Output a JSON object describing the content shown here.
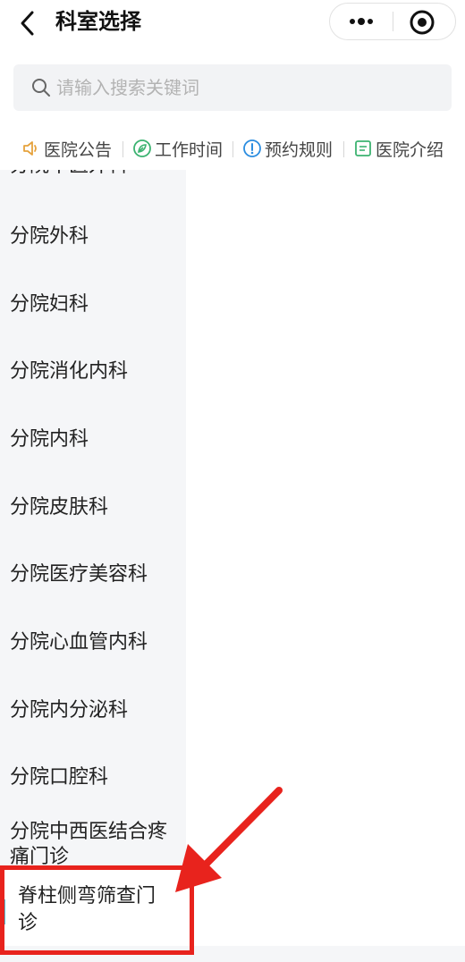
{
  "nav": {
    "title": "科室选择",
    "back_icon": "chevron-left-icon",
    "more_icon": "more-dots-icon",
    "close_icon": "target-circle-icon"
  },
  "search": {
    "placeholder": "请输入搜索关键词",
    "icon": "search-icon"
  },
  "tabs": [
    {
      "label": "医院公告",
      "icon": "speaker-icon",
      "color": "#e6a23c"
    },
    {
      "label": "工作时间",
      "icon": "leaf-icon",
      "color": "#3cb371"
    },
    {
      "label": "预约规则",
      "icon": "info-icon",
      "color": "#2b8de0"
    },
    {
      "label": "医院介绍",
      "icon": "document-icon",
      "color": "#3cb371"
    }
  ],
  "departments": [
    {
      "label": "分院中医外科"
    },
    {
      "label": "分院外科"
    },
    {
      "label": "分院妇科"
    },
    {
      "label": "分院消化内科"
    },
    {
      "label": "分院内科"
    },
    {
      "label": "分院皮肤科"
    },
    {
      "label": "分院医疗美容科"
    },
    {
      "label": "分院心血管内科"
    },
    {
      "label": "分院内分泌科"
    },
    {
      "label": "分院口腔科"
    },
    {
      "label": "分院中西医结合疼痛门诊"
    }
  ],
  "selected_department": "脊柱侧弯筛查门诊",
  "colors": {
    "highlight": "#e8231d",
    "selected_bar": "#4fc3d8",
    "sidebar_bg": "#f5f6f8"
  }
}
